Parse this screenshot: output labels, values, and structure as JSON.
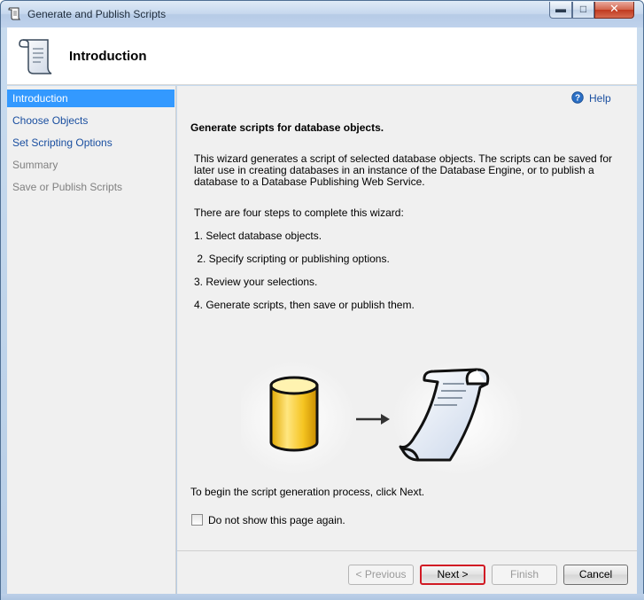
{
  "window": {
    "title": "Generate and Publish Scripts"
  },
  "header": {
    "title": "Introduction"
  },
  "nav": {
    "items": [
      {
        "label": "Introduction",
        "state": "selected"
      },
      {
        "label": "Choose Objects",
        "state": "enabled"
      },
      {
        "label": "Set Scripting Options",
        "state": "enabled"
      },
      {
        "label": "Summary",
        "state": "disabled"
      },
      {
        "label": "Save or Publish Scripts",
        "state": "disabled"
      }
    ]
  },
  "main": {
    "help_label": "Help",
    "heading": "Generate scripts for database objects.",
    "description": "This wizard generates a script of selected database objects. The scripts can be saved for later use in creating databases in an instance of the Database Engine, or to publish a database to a Database Publishing Web Service.",
    "steps_intro": "There are four steps to complete this wizard:",
    "steps": [
      "1. Select database objects.",
      " 2. Specify scripting or publishing options.",
      "3. Review your selections.",
      "4. Generate scripts, then save or publish them."
    ],
    "begin_text": "To begin the script generation process, click Next.",
    "checkbox_label": "Do not show this page again.",
    "checkbox_checked": false
  },
  "buttons": {
    "previous": "< Previous",
    "next": "Next >",
    "finish": "Finish",
    "cancel": "Cancel"
  },
  "icons": {
    "window": "scroll-icon",
    "header": "scroll-icon",
    "help": "help-circle-icon",
    "database": "database-cylinder-icon",
    "arrow": "arrow-right-icon",
    "script": "script-scroll-icon"
  },
  "colors": {
    "selection": "#3399ff",
    "link": "#1a4fa0",
    "highlight_border": "#d11a24"
  }
}
